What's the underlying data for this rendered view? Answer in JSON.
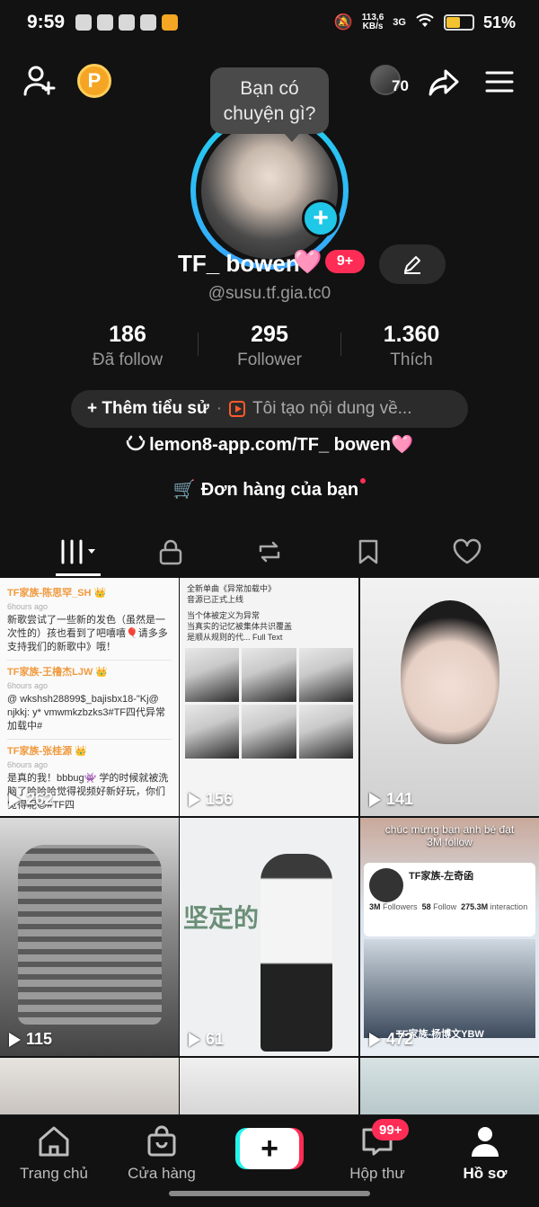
{
  "status_bar": {
    "time": "9:59",
    "net_speed": "113,6",
    "net_speed_unit": "KB/s",
    "signal": "3G",
    "battery": "51%"
  },
  "profile": {
    "visitor_count": "70",
    "bubble_text": "Bạn có chuyện gì?",
    "display_name": "TF_ bowen",
    "name_emoji": "🩷",
    "notif_badge": "9+",
    "handle": "@susu.tf.gia.tc0",
    "stats": [
      {
        "value": "186",
        "label": "Đã follow"
      },
      {
        "value": "295",
        "label": "Follower"
      },
      {
        "value": "1.360",
        "label": "Thích"
      }
    ],
    "bio_add": "+ Thêm tiểu sử",
    "bio_sep": "·",
    "bio_desc": "Tôi tạo nội dung về...",
    "link": "lemon8-app.com/TF_ bowen",
    "link_emoji": "🩷",
    "orders": "Đơn hàng của bạn"
  },
  "grid": {
    "views": [
      "262",
      "156",
      "141",
      "115",
      "61",
      "472"
    ],
    "cell1": {
      "posts": [
        {
          "user": "TF家族-陈思罕_SH 👑",
          "time": "6hours ago",
          "text": "新歌尝试了一些新的发色（虽然是一次性的）孩也看到了吧嘻嘻🎈请多多支持我们的新歌中》哦！"
        },
        {
          "user": "TF家族-王橹杰LJW 👑",
          "time": "6hours ago",
          "text": "@ wkshsh28899$_bajisbx18-\"Kj@ njkkj: y* vmwmkzbzks3#TF四代异常加载中#"
        },
        {
          "user": "TF家族-张桂源 👑",
          "time": "6hours ago",
          "text": "是真的我！bbbug👾 学的时候就被洗脑了哈哈哈觉得视频好新好玩，你们觉得呢😊#TF四"
        }
      ]
    },
    "cell2": {
      "lines": [
        "全新单曲《异常加载中》",
        "音源已正式上线",
        "当个体被定义为异常",
        "当真实的记忆被集体共识覆盖",
        "是顺从规则的代... Full Text"
      ]
    },
    "cell5": {
      "caption": "坚定的"
    },
    "cell6": {
      "message_line1": "chúc mừng bạn anh bé đạt",
      "message_line2": "3M follow",
      "card_name": "TF家族-左奇函",
      "followers": "3M",
      "followers_label": "Followers",
      "following": "58",
      "following_label": "Follow",
      "interaction": "275.3M",
      "interaction_label": "interaction",
      "lower_name": "TF家族-杨博文YBW"
    }
  },
  "bottom_nav": {
    "home": "Trang chủ",
    "shop": "Cửa hàng",
    "inbox": "Hộp thư",
    "inbox_badge": "99+",
    "profile": "Hồ sơ"
  }
}
